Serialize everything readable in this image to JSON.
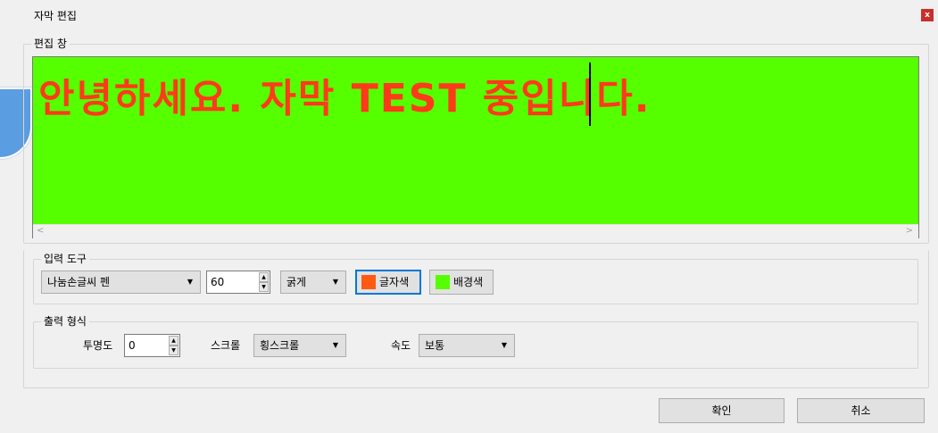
{
  "window": {
    "title": "자막 편집",
    "close_label": "x"
  },
  "editor_group": {
    "title": "편집 창",
    "text": "안녕하세요. 자막 TEST 중입니다.",
    "background_color": "#55ff00",
    "text_color": "#ff3a1a",
    "scroll_left": "<",
    "scroll_right": ">"
  },
  "input_tools": {
    "title": "입력 도구",
    "font": "나눔손글씨 펜",
    "size": "60",
    "weight": "굵게",
    "text_color_label": "글자색",
    "text_color_swatch": "#ff5a14",
    "bg_color_label": "배경색",
    "bg_color_swatch": "#55ff00"
  },
  "output_format": {
    "title": "출력 형식",
    "opacity_label": "투명도",
    "opacity_value": "0",
    "scroll_label": "스크롤",
    "scroll_value": "횡스크롤",
    "speed_label": "속도",
    "speed_value": "보통"
  },
  "footer": {
    "ok_label": "확인",
    "cancel_label": "취소"
  }
}
